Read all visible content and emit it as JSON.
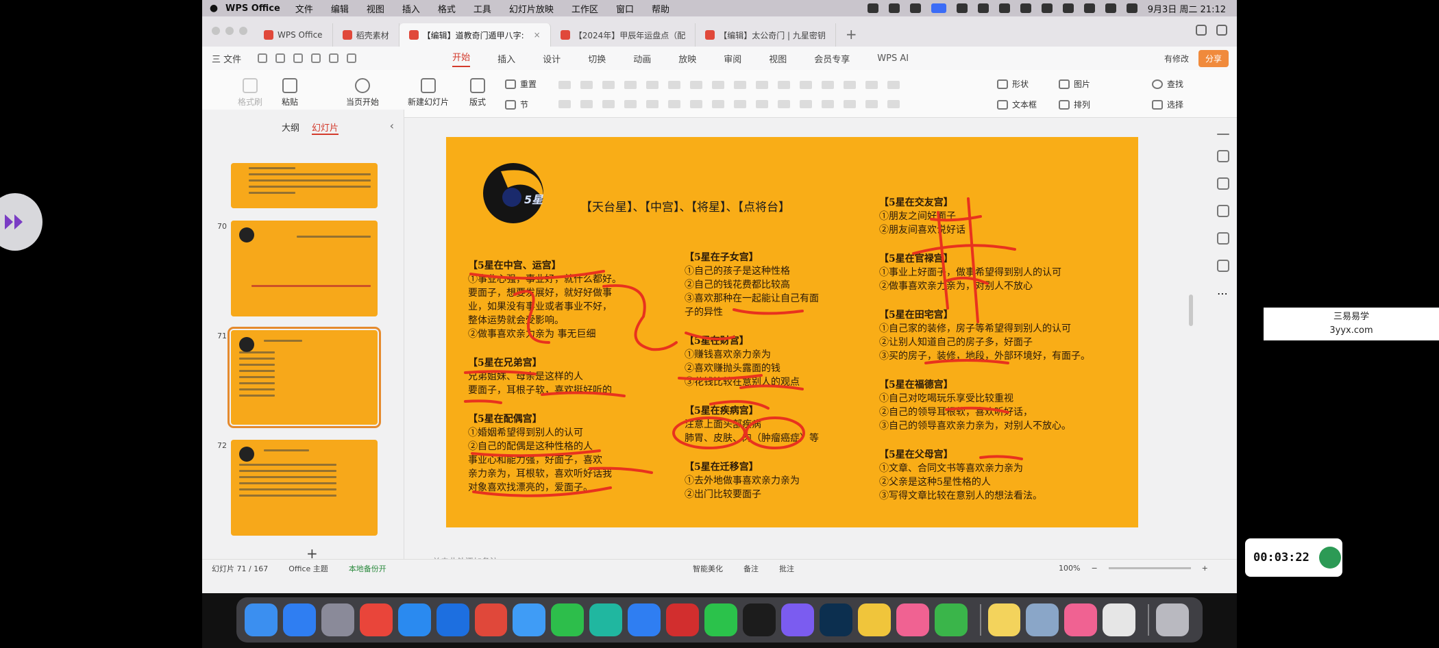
{
  "menubar": {
    "app_name": "WPS Office",
    "items": [
      "文件",
      "编辑",
      "视图",
      "插入",
      "格式",
      "工具",
      "幻灯片放映",
      "工作区",
      "窗口",
      "帮助"
    ],
    "datetime": "9月3日 周二 21:12"
  },
  "tabs": [
    {
      "label": "WPS Office",
      "color": "#e0483a"
    },
    {
      "label": "稻壳素材",
      "color": "#e0483a"
    },
    {
      "label": "【编辑】道教奇门遁甲八字:",
      "color": "#e0483a",
      "active": true
    },
    {
      "label": "【2024年】甲辰年运盘点（配",
      "color": "#e0483a"
    },
    {
      "label": "【编辑】太公奇门 | 九星密钥",
      "color": "#e0483a"
    }
  ],
  "ribbon_tabs": {
    "file": "三 文件",
    "items": [
      "开始",
      "插入",
      "设计",
      "切换",
      "动画",
      "放映",
      "审阅",
      "视图",
      "会员专享"
    ],
    "ai": "WPS AI",
    "edit_status": "有修改",
    "share": "分享"
  },
  "ribbon": {
    "format_painter": "格式刷",
    "paste": "粘贴",
    "play_from_start": "当页开始",
    "new_slide": "新建幻灯片",
    "layout": "版式",
    "reset": "重置",
    "section": "节",
    "shape": "形状",
    "picture": "图片",
    "find": "查找",
    "textbox": "文本框",
    "arrange": "排列",
    "select": "选择"
  },
  "left_panel": {
    "tab_outline": "大纲",
    "tab_slides": "幻灯片",
    "thumb_numbers": [
      "70",
      "71",
      "72"
    ]
  },
  "slide": {
    "logo_text": "5星",
    "header": "【天台星】、【中宫】、【将星】、【点将台】",
    "col1": [
      {
        "title": "【5星在中宫、运宫】",
        "lines": [
          "①事业心强，事业好，就什么都好。",
          "要面子，想要发展好，就好好做事",
          "业，如果没有事业或者事业不好，",
          "整体运势就会受影响。",
          "②做事喜欢亲力亲为 事无巨细"
        ]
      },
      {
        "title": "【5星在兄弟宫】",
        "lines": [
          "兄弟姐妹、母亲是这样的人",
          "要面子，耳根子软，喜欢挺好听的"
        ]
      },
      {
        "title": "【5星在配偶宫】",
        "lines": [
          "①婚姻希望得到别人的认可",
          "②自己的配偶是这种性格的人",
          "事业心和能力强，好面子，喜欢",
          "亲力亲为，耳根软，喜欢听好话我",
          "对象喜欢找漂亮的，爱面子。"
        ]
      }
    ],
    "col2": [
      {
        "title": "【5星在子女宫】",
        "lines": [
          "①自己的孩子是这种性格",
          "②自己的钱花费都比较高",
          "③喜欢那种在一起能让自己有面",
          "子的异性"
        ]
      },
      {
        "title": "【5星在财宫】",
        "lines": [
          "①赚钱喜欢亲力亲为",
          "②喜欢赚抛头露面的钱",
          "③花钱比较在意别人的观点"
        ]
      },
      {
        "title": "【5星在疾病宫】",
        "lines": [
          "注意上面头部疾病",
          "肺胃、皮肤、肉（肿瘤癌症）等"
        ]
      },
      {
        "title": "【5星在迁移宫】",
        "lines": [
          "①去外地做事喜欢亲力亲为",
          "②出门比较要面子"
        ]
      }
    ],
    "col3": [
      {
        "title": "【5星在交友宫】",
        "lines": [
          "①朋友之间好面子",
          "②朋友间喜欢说好话"
        ]
      },
      {
        "title": "【5星在官禄宫】",
        "lines": [
          "①事业上好面子，做事希望得到别人的认可",
          "②做事喜欢亲力亲为，对别人不放心"
        ]
      },
      {
        "title": "【5星在田宅宫】",
        "lines": [
          "①自己家的装修，房子等希望得到别人的认可",
          "②让别人知道自己的房子多，好面子",
          "③买的房子，装修，地段，外部环境好，有面子。"
        ]
      },
      {
        "title": "【5星在福德宫】",
        "lines": [
          "①自己对吃喝玩乐享受比较重视",
          "②自己的领导耳根软，喜欢听好话，",
          "③自己的领导喜欢亲力亲为，对别人不放心。"
        ]
      },
      {
        "title": "【5星在父母宫】",
        "lines": [
          "①文章、合同文书等喜欢亲力亲为",
          "②父亲是这种5星性格的人",
          "③写得文章比较在意别人的想法看法。"
        ]
      }
    ]
  },
  "notes_placeholder": "单击此处添加备注",
  "statusbar": {
    "slide_count": "幻灯片 71 / 167",
    "theme": "Office 主题",
    "backup": "本地备份开",
    "beautify": "智能美化",
    "notes": "备注",
    "comments": "批注",
    "zoom": "100%"
  },
  "timer": "00:03:22",
  "watermark": {
    "line1": "三易易学",
    "line2": "3yyx.com"
  },
  "dock": [
    {
      "name": "finder",
      "color": "#3b8ff0"
    },
    {
      "name": "app-store",
      "color": "#2f7ef2"
    },
    {
      "name": "launchpad",
      "color": "#8a8a99"
    },
    {
      "name": "chrome",
      "color": "#e9453a"
    },
    {
      "name": "safari",
      "color": "#2a8af0"
    },
    {
      "name": "arrow-app",
      "color": "#1d6fe0"
    },
    {
      "name": "wps",
      "color": "#e0483a"
    },
    {
      "name": "baidu-netdisk",
      "color": "#3f9cf6"
    },
    {
      "name": "iqiyi",
      "color": "#2dbe4b"
    },
    {
      "name": "video-player",
      "color": "#20b7a0"
    },
    {
      "name": "lark",
      "color": "#2f7ef2"
    },
    {
      "name": "netease-music",
      "color": "#d22e2e"
    },
    {
      "name": "wechat",
      "color": "#2bc24b"
    },
    {
      "name": "qq",
      "color": "#1c1c1c"
    },
    {
      "name": "bilibili-b",
      "color": "#7b5cf0"
    },
    {
      "name": "photoshop",
      "color": "#0c2f4f"
    },
    {
      "name": "vector-app",
      "color": "#f0c53b"
    },
    {
      "name": "bilibili",
      "color": "#f06292"
    },
    {
      "name": "game-app",
      "color": "#3ab54a"
    },
    {
      "name": "notes",
      "color": "#f3d35c"
    },
    {
      "name": "preview",
      "color": "#8aa6c8"
    },
    {
      "name": "bilibili-2",
      "color": "#f06292"
    },
    {
      "name": "doc-app",
      "color": "#e6e6e6"
    },
    {
      "name": "trash",
      "color": "#b9b9c0"
    }
  ]
}
